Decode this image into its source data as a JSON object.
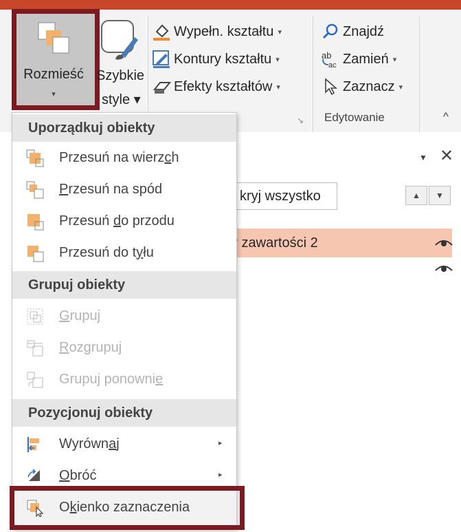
{
  "ribbon": {
    "arrange": {
      "label": "Rozmieść",
      "caret": "▾"
    },
    "quick_styles": {
      "label_line1": "Szybkie",
      "label_line2": "style ▾"
    },
    "shape_fill": {
      "label": "Wypełn. kształtu",
      "caret": "▾"
    },
    "shape_outline": {
      "label": "Kontury kształtu",
      "caret": "▾"
    },
    "shape_effects": {
      "label": "Efekty kształtów",
      "caret": "▾"
    },
    "find": {
      "label": "Znajdź"
    },
    "replace": {
      "label": "Zamień",
      "caret": "▾",
      "icon_text": "ab"
    },
    "select": {
      "label": "Zaznacz",
      "caret": "▾"
    },
    "editing_group_label": "Edytowanie",
    "dialog_launcher": "↘",
    "collapse": "^"
  },
  "selection_pane": {
    "menu_arrow": "▼",
    "close": "✕",
    "hide_all_partial": "kryj wszystko",
    "move_up": "▲",
    "move_down": "▼",
    "row1_partial": "y zawartości 2"
  },
  "menu": {
    "sections": [
      {
        "header": "Uporządkuj obiekty"
      },
      {
        "header": "Grupuj obiekty"
      },
      {
        "header": "Pozycjonuj obiekty"
      }
    ],
    "submenu_arrow": "▸"
  },
  "colors": {
    "highlight_border": "#7b1a20",
    "accent_orange": "#f2b26b",
    "selected_row": "#f7c6b1",
    "top_strip": "#c8472b"
  }
}
